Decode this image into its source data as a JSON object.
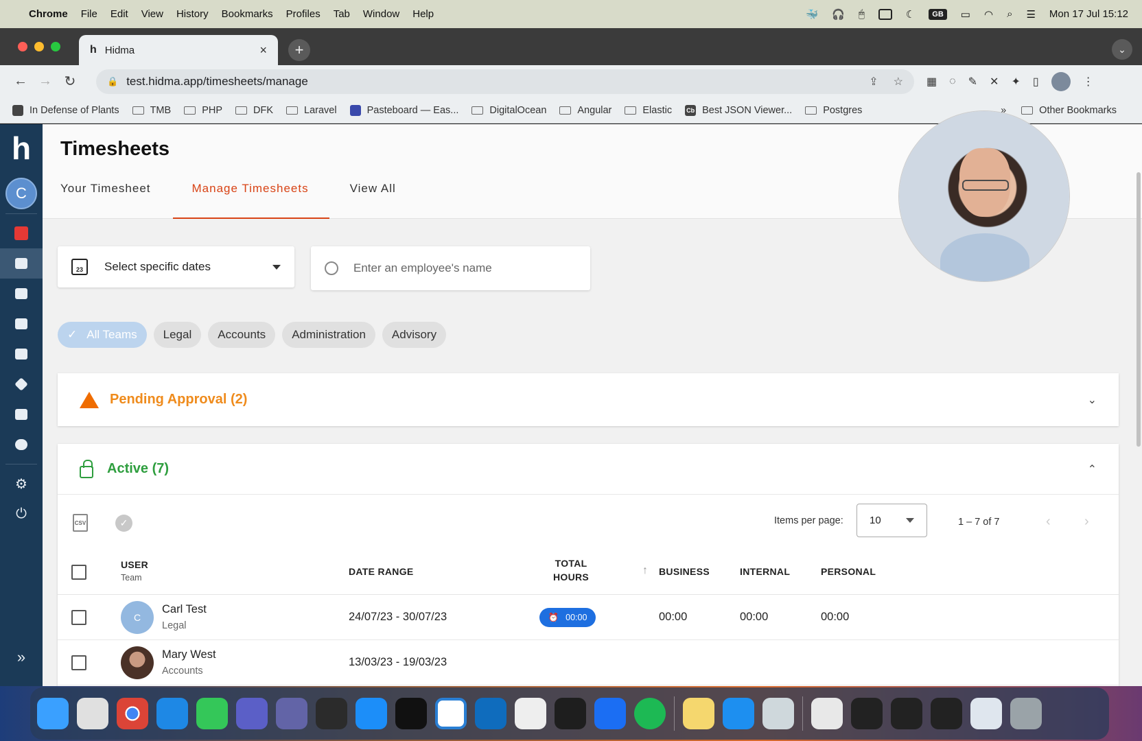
{
  "menubar": {
    "app": "Chrome",
    "items": [
      "File",
      "Edit",
      "View",
      "History",
      "Bookmarks",
      "Profiles",
      "Tab",
      "Window",
      "Help"
    ],
    "keyboard": "GB",
    "clock": "Mon 17 Jul  15:12"
  },
  "browser": {
    "tab_title": "Hidma",
    "tab_favicon": "h",
    "url": "test.hidma.app/timesheets/manage",
    "bookmarks": [
      "In Defense of Plants",
      "TMB",
      "PHP",
      "DFK",
      "Laravel",
      "Pasteboard — Eas...",
      "DigitalOcean",
      "Angular",
      "Elastic",
      "Best JSON Viewer...",
      "Postgres"
    ],
    "bookmarks_more": "»",
    "other_bookmarks": "Other Bookmarks"
  },
  "rail": {
    "logo": "h",
    "avatar_initial": "C",
    "items": [
      "record-icon",
      "timesheets-icon",
      "people-clock-icon",
      "clipboard-icon",
      "clipboard-check-icon",
      "tag-icon",
      "chart-icon",
      "team-icon"
    ],
    "bottom": [
      "gear-icon",
      "power-icon"
    ],
    "expand": "»"
  },
  "page": {
    "title": "Timesheets",
    "tabs": [
      "Your Timesheet",
      "Manage Timesheets",
      "View All"
    ],
    "active_tab": "Manage Timesheets"
  },
  "filters": {
    "calendar_badge": "23",
    "date_select": "Select specific dates",
    "search_placeholder": "Enter an employee's name",
    "chips": [
      "All Teams",
      "Legal",
      "Accounts",
      "Administration",
      "Advisory"
    ],
    "selected_chip": "All Teams"
  },
  "pending": {
    "title": "Pending Approval (2)",
    "color": "#ef8b1c"
  },
  "active": {
    "title": "Active (7)",
    "color": "#2e9e3e",
    "csv_label": "CSV",
    "items_per_page_label": "Items per page:",
    "items_per_page": "10",
    "range": "1 – 7 of 7",
    "columns": {
      "user": "USER",
      "team": "Team",
      "date_range": "DATE RANGE",
      "total_hours_1": "TOTAL",
      "total_hours_2": "HOURS",
      "business": "BUSINESS",
      "internal": "INTERNAL",
      "personal": "PERSONAL"
    },
    "rows": [
      {
        "initial": "C",
        "name": "Carl Test",
        "team": "Legal",
        "date_range": "24/07/23 - 30/07/23",
        "total_hours": "00:00",
        "business": "00:00",
        "internal": "00:00",
        "personal": "00:00"
      },
      {
        "name": "Mary West",
        "team": "Accounts",
        "date_range": "13/03/23 - 19/03/23"
      }
    ]
  }
}
